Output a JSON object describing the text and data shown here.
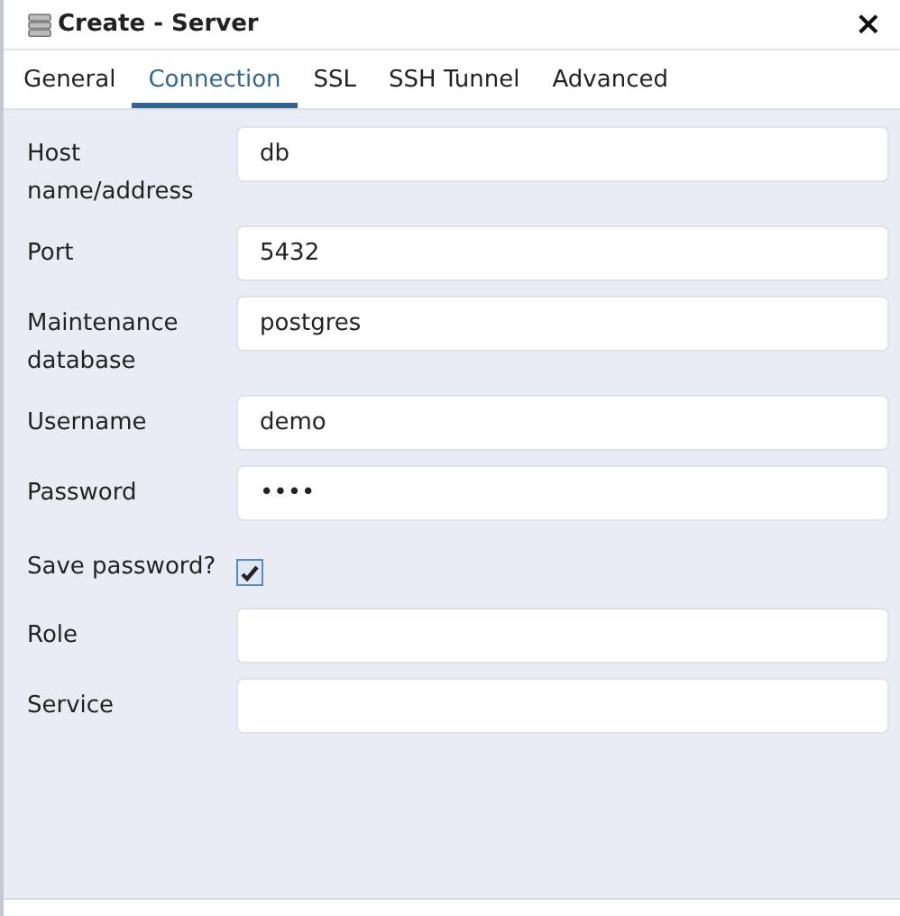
{
  "window": {
    "title": "Create - Server",
    "close": "×"
  },
  "tabs": [
    {
      "label": "General",
      "selected": false
    },
    {
      "label": "Connection",
      "selected": true
    },
    {
      "label": "SSL",
      "selected": false
    },
    {
      "label": "SSH Tunnel",
      "selected": false
    },
    {
      "label": "Advanced",
      "selected": false
    }
  ],
  "fields": [
    {
      "kind": "text",
      "label": "Host name/address",
      "value": "db"
    },
    {
      "kind": "text",
      "label": "Port",
      "value": "5432"
    },
    {
      "kind": "text",
      "label": "Maintenance database",
      "value": "postgres"
    },
    {
      "kind": "text",
      "label": "Username",
      "value": "demo"
    },
    {
      "kind": "text",
      "label": "Password",
      "value": "••••"
    },
    {
      "kind": "checkbox",
      "label": "Save password?",
      "checked": true
    },
    {
      "kind": "text",
      "label": "Role"
    },
    {
      "kind": "text",
      "label": "Service"
    }
  ]
}
